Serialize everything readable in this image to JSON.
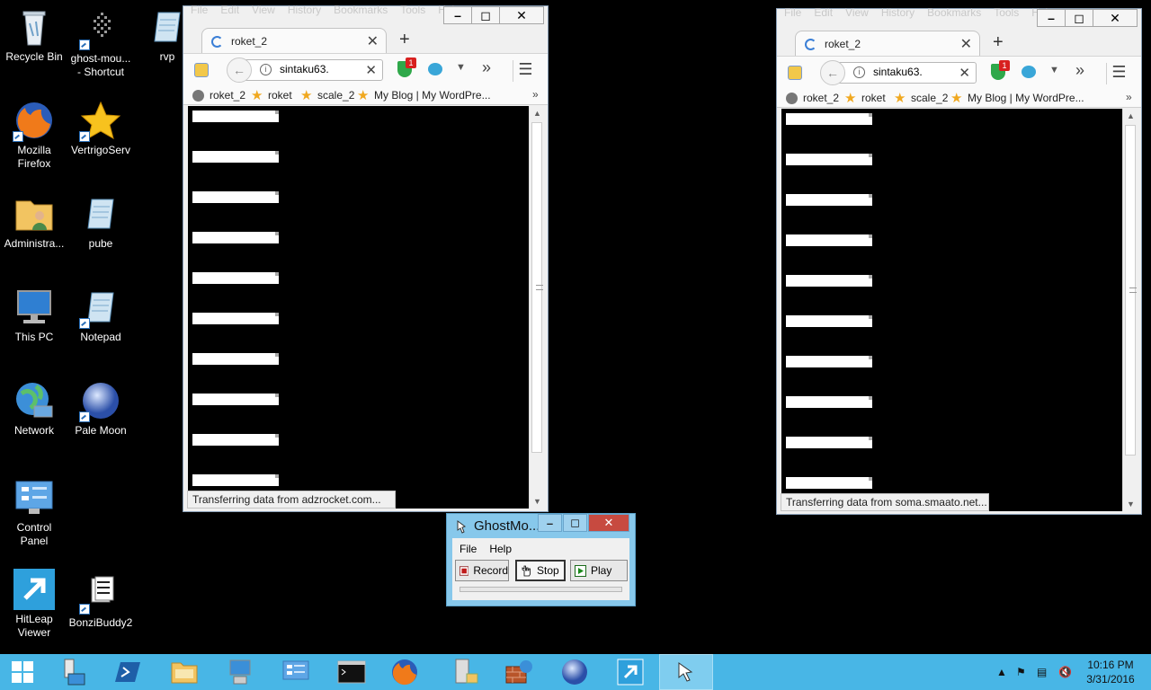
{
  "desktop": {
    "icons": {
      "recycle_bin": "Recycle Bin",
      "ghost_mouse": "ghost-mou...\n- Shortcut",
      "rvp": "rvp",
      "firefox": "Mozilla\nFirefox",
      "vertigo": "VertrigoServ",
      "administrator": "Administra...",
      "pube": "pube",
      "this_pc": "This PC",
      "notepad": "Notepad",
      "network": "Network",
      "pale_moon": "Pale Moon",
      "control_panel": "Control\nPanel",
      "hitleap": "HitLeap\nViewer",
      "bonzibuddy": "BonziBuddy2"
    }
  },
  "browser_left": {
    "menu": [
      "File",
      "Edit",
      "View",
      "History",
      "Bookmarks",
      "Tools",
      "Help"
    ],
    "tab_title": "roket_2",
    "url": "sintaku63.",
    "badge_count": "1",
    "bookmarks": [
      "roket_2",
      "roket",
      "scale_2",
      "My Blog | My WordPre..."
    ],
    "status": "Transferring data from adzrocket.com..."
  },
  "browser_right": {
    "menu": [
      "File",
      "Edit",
      "View",
      "History",
      "Bookmarks",
      "Tools",
      "Help"
    ],
    "tab_title": "roket_2",
    "url": "sintaku63.",
    "badge_count": "1",
    "bookmarks": [
      "roket_2",
      "roket",
      "scale_2",
      "My Blog | My WordPre..."
    ],
    "status": "Transferring data from soma.smaato.net..."
  },
  "ghostmouse": {
    "title": "GhostMo...",
    "menu": [
      "File",
      "Help"
    ],
    "record_label": "Record",
    "stop_label": "Stop",
    "play_label": "Play"
  },
  "taskbar": {
    "time": "10:16 PM",
    "date": "3/31/2016"
  },
  "colors": {
    "taskbar": "#48b6e6",
    "ghostmouse_frame": "#87c8eb",
    "close_red": "#c74a40"
  }
}
